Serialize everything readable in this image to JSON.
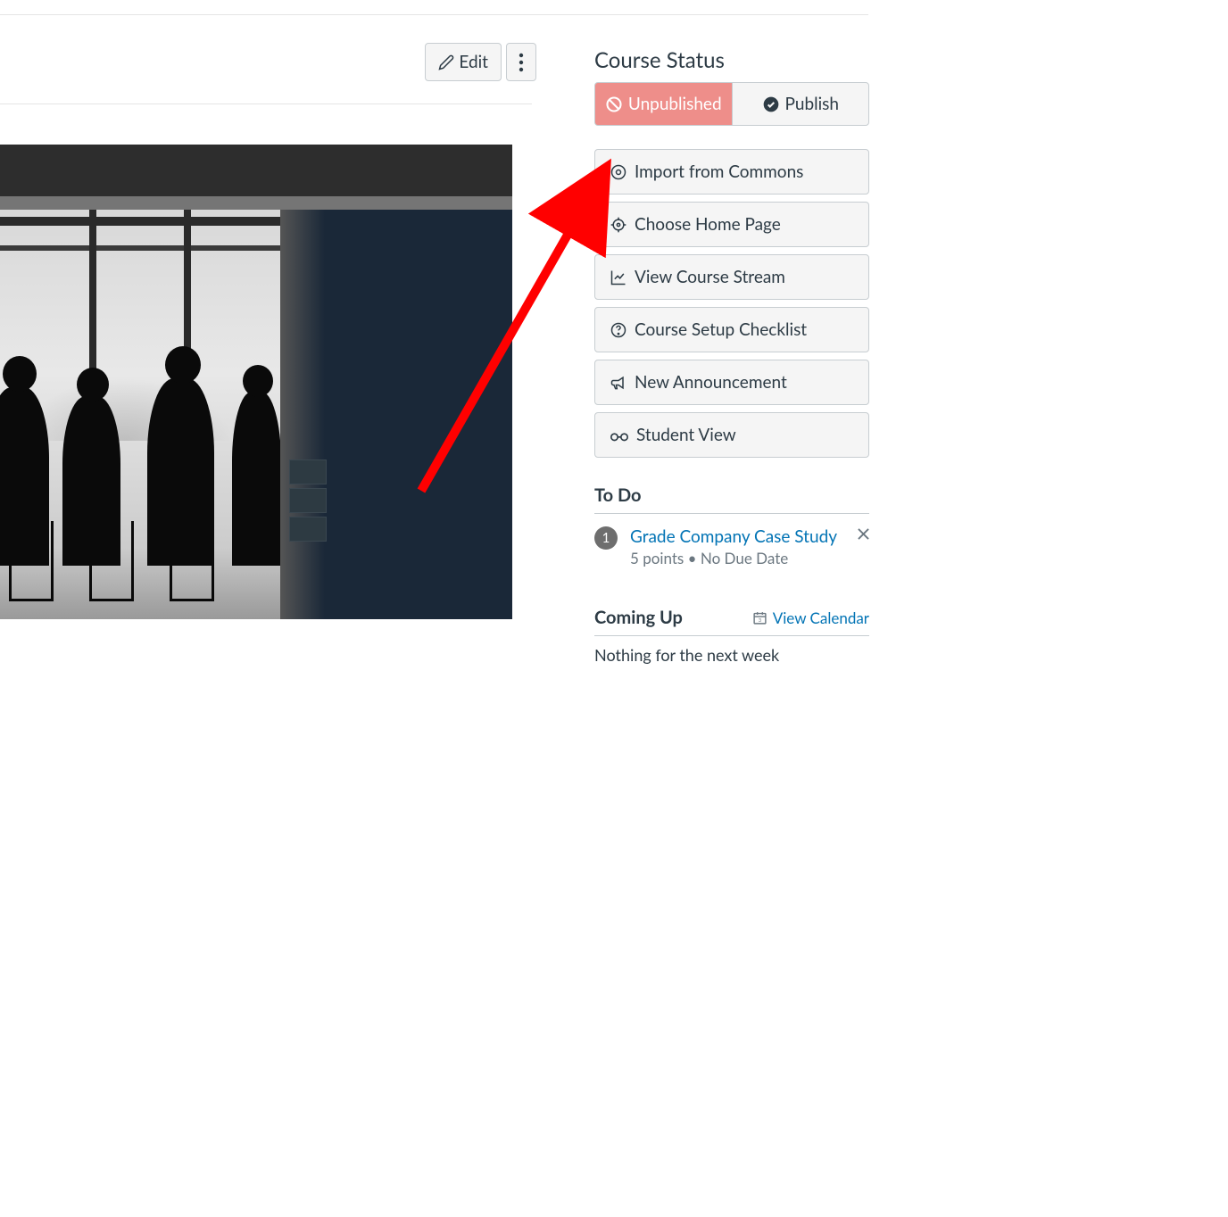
{
  "toolbar": {
    "edit": "Edit"
  },
  "sidebar": {
    "status_title": "Course Status",
    "unpublished": "Unpublished",
    "publish": "Publish",
    "actions": {
      "import_commons": "Import from Commons",
      "choose_home": "Choose Home Page",
      "view_stream": "View Course Stream",
      "setup_checklist": "Course Setup Checklist",
      "new_announcement": "New Announcement",
      "student_view": "Student View"
    },
    "todo": {
      "title": "To Do",
      "badge": "1",
      "item_title": "Grade Company Case Study",
      "item_meta": "5 points • No Due Date"
    },
    "coming_up": {
      "title": "Coming Up",
      "view_calendar": "View Calendar",
      "empty": "Nothing for the next week"
    }
  }
}
